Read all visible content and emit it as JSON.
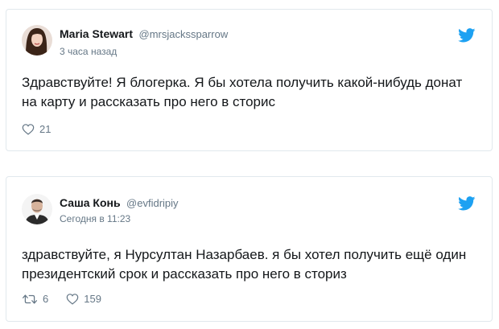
{
  "tweets": [
    {
      "display_name": "Maria Stewart",
      "handle": "@mrsjackssparrow",
      "timestamp": "3 часа назад",
      "text": "Здравствуйте! Я блогерка. Я бы хотела получить какой-нибудь донат на карту и рассказать про него в сторис",
      "likes": "21"
    },
    {
      "display_name": "Саша Конь",
      "handle": "@evfidripiy",
      "timestamp": "Сегодня в 11:23",
      "text": "здравствуйте, я Нурсултан Назарбаев. я бы хотел получить ещё один президентский срок и рассказать про него в сториз",
      "retweets": "6",
      "likes": "159"
    }
  ],
  "icons": {
    "brand": "twitter-bird-icon",
    "like": "heart-icon",
    "retweet": "retweet-icon"
  },
  "colors": {
    "twitter_blue": "#1da1f2",
    "text": "#14171a",
    "muted": "#657786",
    "border": "#e1e8ed"
  }
}
